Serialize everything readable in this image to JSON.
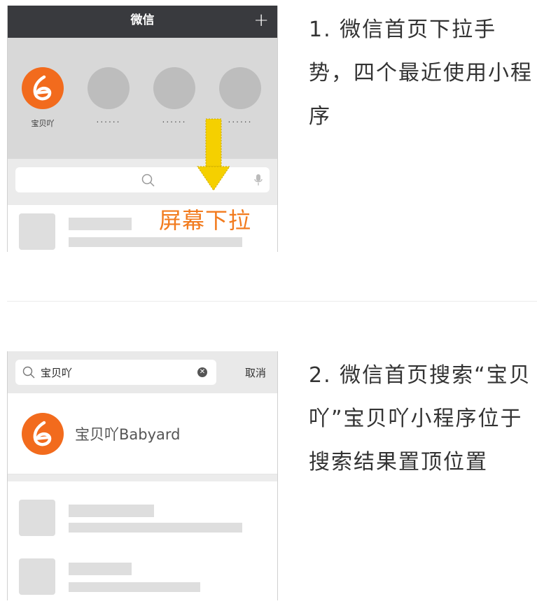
{
  "panel1": {
    "header_title": "微信",
    "plus_icon": "+",
    "recent_apps": [
      {
        "name": "宝贝吖"
      },
      {
        "name": "......"
      },
      {
        "name": "......"
      },
      {
        "name": "......"
      }
    ],
    "pull_label": "屏幕下拉",
    "description": "1. 微信首页下拉手势，四个最近使用小程序"
  },
  "panel2": {
    "search_query": "宝贝吖",
    "cancel_label": "取消",
    "result_name": "宝贝吖Babyard",
    "description": "2. 微信首页搜索“宝贝吖”宝贝吖小程序位于搜索结果置顶位置"
  },
  "colors": {
    "brand_orange": "#f26b1d",
    "header_dark": "#393a3e",
    "pull_text": "#f27b1e",
    "arrow_yellow": "#f5d000"
  }
}
